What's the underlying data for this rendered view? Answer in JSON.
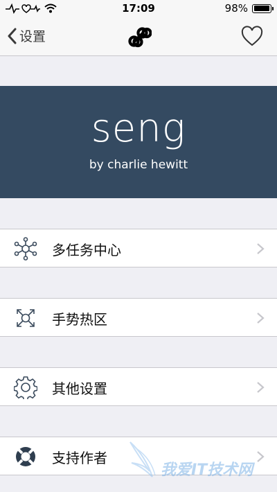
{
  "status_bar": {
    "time": "17:09",
    "battery": "98%",
    "battery_level": 0.98
  },
  "nav": {
    "back_label": "设置"
  },
  "banner": {
    "app_name": "seng",
    "byline": "by charlie hewitt",
    "bg_color": "#344a61"
  },
  "menu": [
    {
      "label": "多任务中心",
      "icon": "network-hub-icon"
    },
    {
      "label": "手势热区",
      "icon": "expand-arrows-icon"
    },
    {
      "label": "其他设置",
      "icon": "gear-icon"
    },
    {
      "label": "支持作者",
      "icon": "lifebuoy-icon"
    }
  ],
  "watermark": {
    "text": "我爱IT技术网"
  }
}
